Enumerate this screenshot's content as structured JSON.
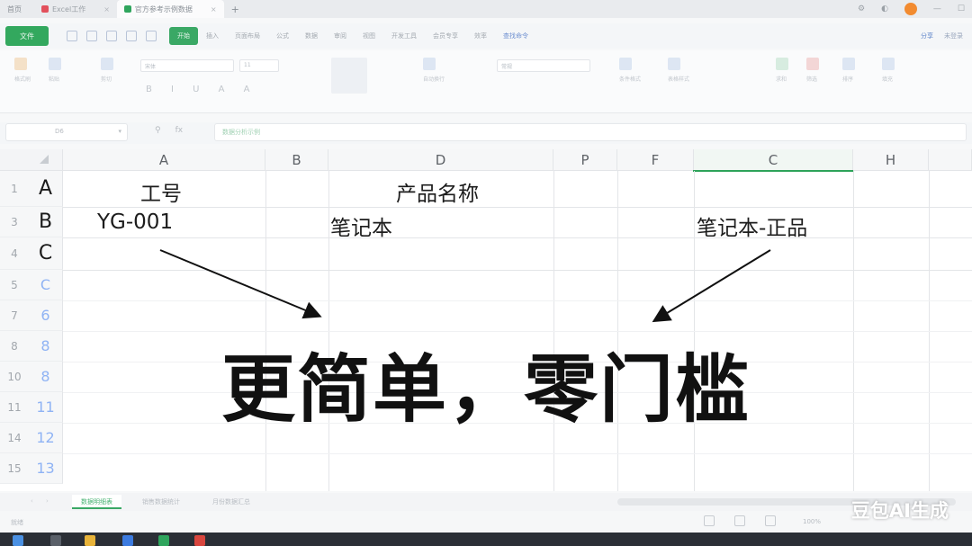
{
  "titlebar": {
    "app": "首页",
    "tabs": [
      {
        "label": "Excel工作",
        "color": "#e2505c",
        "active": false
      },
      {
        "label": "官方参考示例数据",
        "color": "#2fa55d",
        "active": true
      }
    ],
    "add_tab": "+"
  },
  "menubar": {
    "file": "文件",
    "items": [
      "开始",
      "插入",
      "页面布局",
      "公式",
      "数据",
      "审阅",
      "视图",
      "开发工具",
      "会员专享",
      "效率"
    ],
    "active_index": 0,
    "search": "查找命令",
    "right": [
      "分享",
      "未登录"
    ]
  },
  "ribbon": {
    "groups": [
      "格式刷",
      "粘贴",
      "剪切",
      "复制",
      "宋体",
      "11",
      "合并居中",
      "自动换行",
      "常规",
      "条件格式",
      "表格样式",
      "求和",
      "筛选",
      "排序",
      "填充",
      "单元格",
      "行和列",
      "工作表",
      "冻结窗格",
      "查找"
    ],
    "font_name": "宋体",
    "font_size": "11",
    "number_format": "常规"
  },
  "formula_bar": {
    "name_box": "D6",
    "fx": "fx",
    "value": "数据分析示例"
  },
  "grid": {
    "col_headers": [
      "A",
      "B",
      "D",
      "P",
      "F",
      "C",
      "H"
    ],
    "selected_col": "C",
    "rows": [
      {
        "num": "1",
        "tag": "A",
        "cells": {
          "A": "工号",
          "D": "产品名称"
        }
      },
      {
        "num": "3",
        "tag": "B",
        "cells": {
          "A": "YG-001",
          "D": "笔记本",
          "C": "笔记本-正品"
        }
      },
      {
        "num": "4",
        "tag": "C",
        "cells": {}
      },
      {
        "num": "5",
        "tag": "C"
      },
      {
        "num": "7",
        "tag": "6"
      },
      {
        "num": "8",
        "tag": "8"
      },
      {
        "num": "10",
        "tag": "8"
      },
      {
        "num": "11",
        "tag": "11"
      },
      {
        "num": "14",
        "tag": "12"
      },
      {
        "num": "15",
        "tag": "13"
      }
    ]
  },
  "overlay_text": "更简单，零门槛",
  "sheet_tabs": [
    "数据明细表",
    "销售数据统计",
    "月份数据汇总"
  ],
  "status": {
    "left": "就绪",
    "zoom": "100%"
  },
  "watermark": "豆包AI生成"
}
